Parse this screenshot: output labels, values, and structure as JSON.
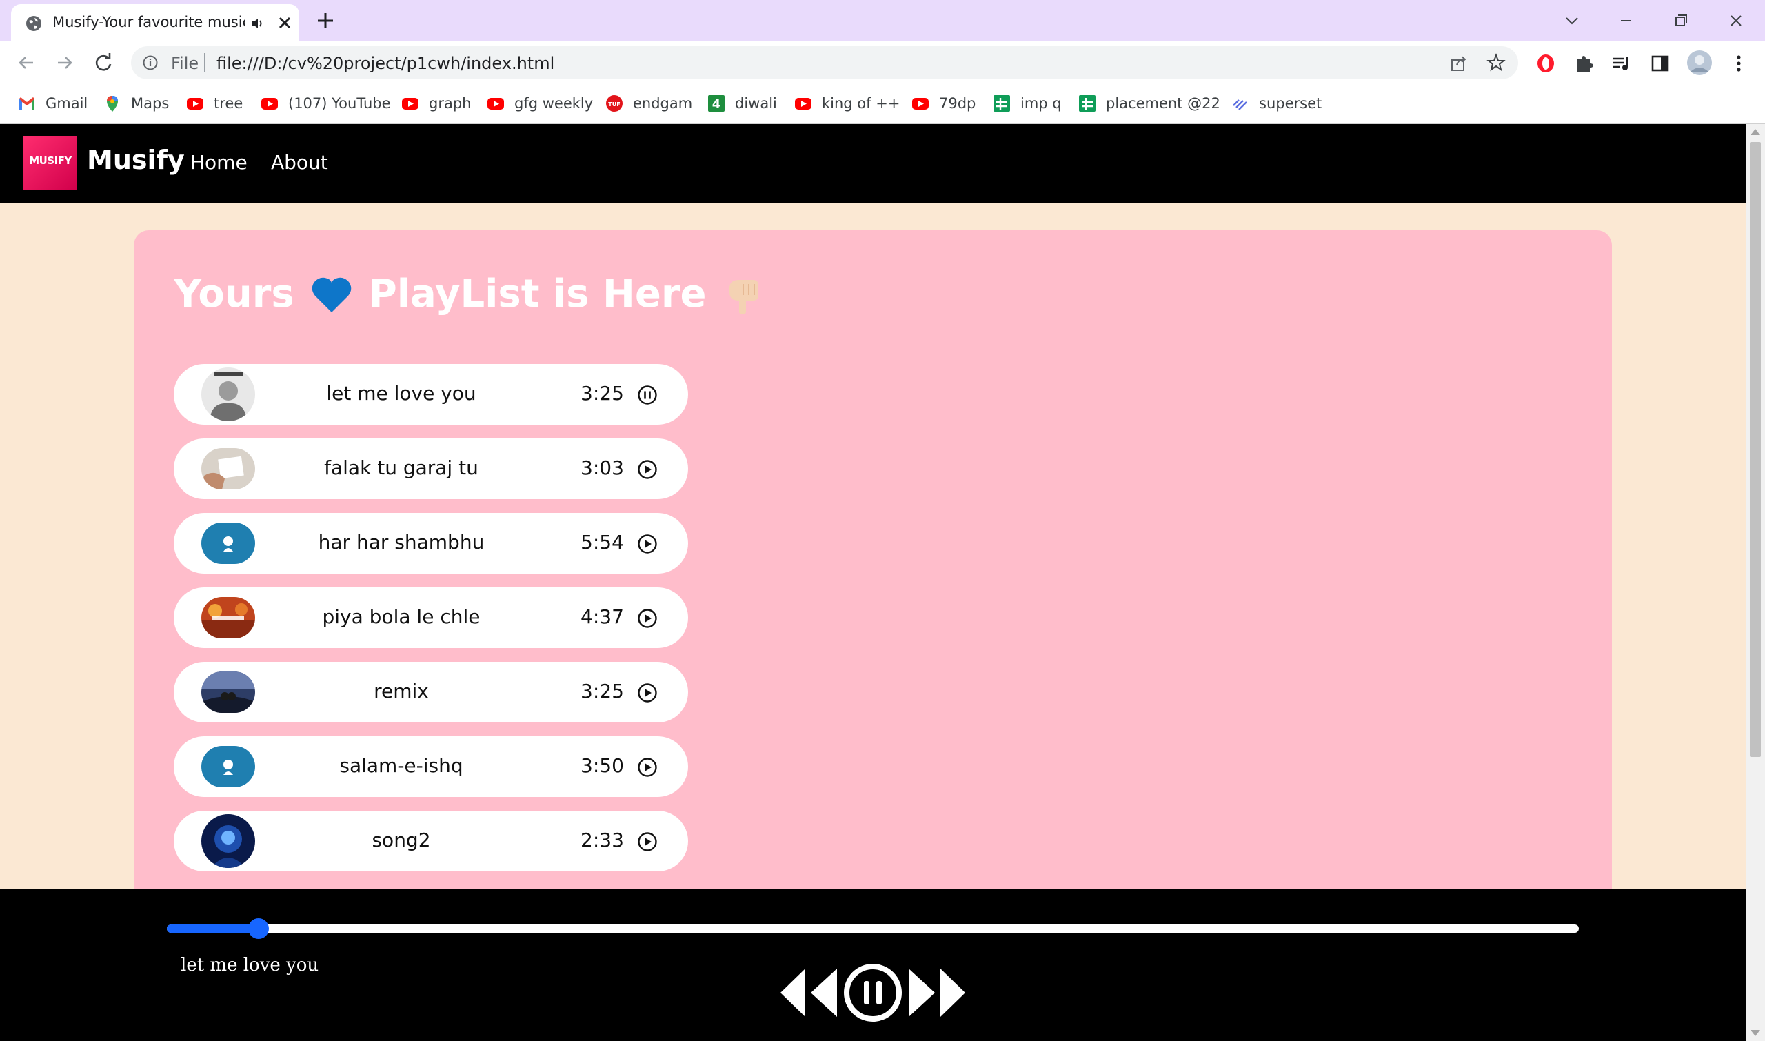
{
  "browser": {
    "tab_title": "Musify-Your favourite music",
    "scheme_label": "File",
    "url": "file:///D:/cv%20project/p1cwh/index.html",
    "bookmarks": [
      {
        "label": "Gmail",
        "icon": "gmail-icon"
      },
      {
        "label": "Maps",
        "icon": "maps-icon"
      },
      {
        "label": "tree",
        "icon": "youtube-icon"
      },
      {
        "label": "(107) YouTube",
        "icon": "youtube-icon"
      },
      {
        "label": "graph",
        "icon": "youtube-icon"
      },
      {
        "label": "gfg weekly",
        "icon": "youtube-icon"
      },
      {
        "label": "endgam",
        "icon": "tuf-icon"
      },
      {
        "label": "diwali",
        "icon": "green-4-icon"
      },
      {
        "label": "king of ++",
        "icon": "youtube-icon"
      },
      {
        "label": "79dp",
        "icon": "youtube-icon"
      },
      {
        "label": "imp q",
        "icon": "sheets-icon"
      },
      {
        "label": "placement @22",
        "icon": "sheets-icon"
      },
      {
        "label": "superset",
        "icon": "superset-icon"
      }
    ]
  },
  "site": {
    "logo_text": "MUSIFY",
    "brand": "Musify",
    "nav": [
      {
        "label": "Home"
      },
      {
        "label": "About"
      }
    ]
  },
  "playlist": {
    "heading_part1": "Yours",
    "heading_part2": "PlayList is Here",
    "heart_color": "#0e76c9",
    "songs": [
      {
        "name": "let me love you",
        "duration": "3:25",
        "state": "pause-icon"
      },
      {
        "name": "falak tu garaj tu",
        "duration": "3:03",
        "state": "play-icon"
      },
      {
        "name": "har har shambhu",
        "duration": "5:54",
        "state": "play-icon"
      },
      {
        "name": "piya bola le chle",
        "duration": "4:37",
        "state": "play-icon"
      },
      {
        "name": "remix",
        "duration": "3:25",
        "state": "play-icon"
      },
      {
        "name": "salam-e-ishq",
        "duration": "3:50",
        "state": "play-icon"
      },
      {
        "name": "song2",
        "duration": "2:33",
        "state": "play-icon"
      }
    ]
  },
  "player": {
    "progress": 0.065,
    "current_song": "let me love you",
    "accent_color": "#1766ff",
    "controls": [
      "previous-icon",
      "pause-icon",
      "next-icon"
    ]
  },
  "colors": {
    "page_bg": "#fbe8d3",
    "card_bg": "#ffbdcb",
    "navbar_bg": "#000000"
  }
}
